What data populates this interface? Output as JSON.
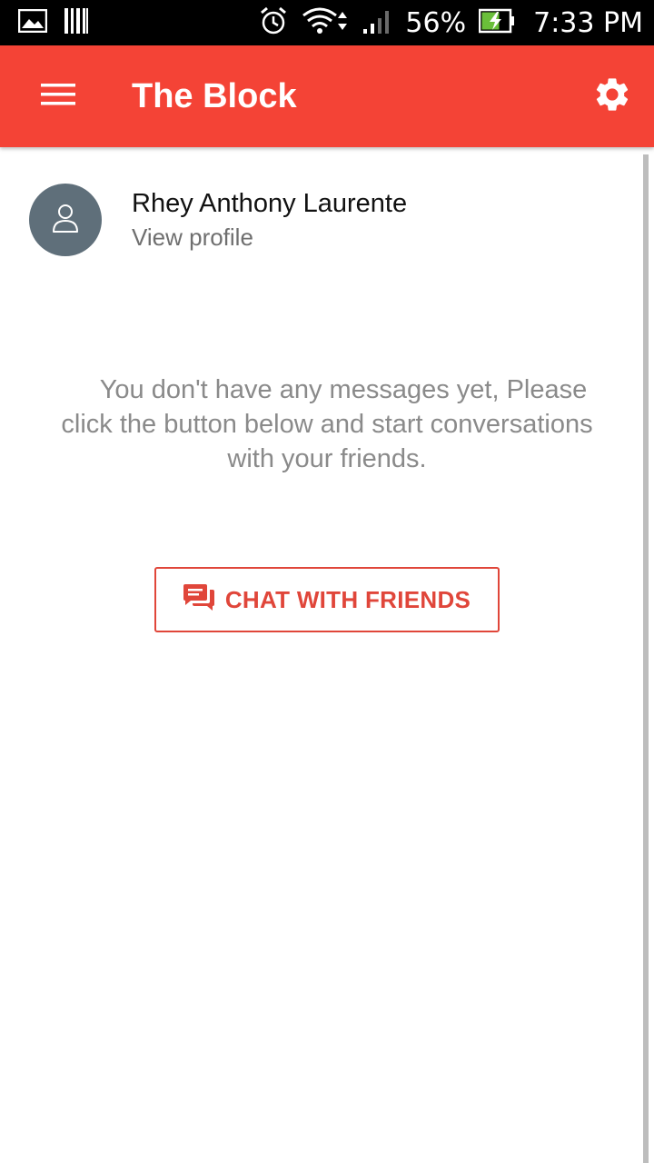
{
  "status_bar": {
    "battery": "56%",
    "time": "7:33 PM",
    "icons": [
      "gallery-icon",
      "barcode-icon",
      "alarm-icon",
      "wifi-icon",
      "signal-icon",
      "battery-charging-icon"
    ]
  },
  "app_bar": {
    "title": "The Block",
    "color": "#f44336",
    "menu_icon": "hamburger-menu-icon",
    "settings_icon": "gear-icon"
  },
  "profile": {
    "name": "Rhey Anthony Laurente",
    "subtitle": "View profile",
    "avatar_color": "#5f6f7a"
  },
  "empty_state": {
    "line1": "You don't have any messages yet, Please",
    "line2": "click the button below and start conversations",
    "line3": "with your friends."
  },
  "chat_button": {
    "label": "CHAT WITH FRIENDS",
    "icon": "chat-bubbles-icon",
    "accent": "#e0463a"
  }
}
